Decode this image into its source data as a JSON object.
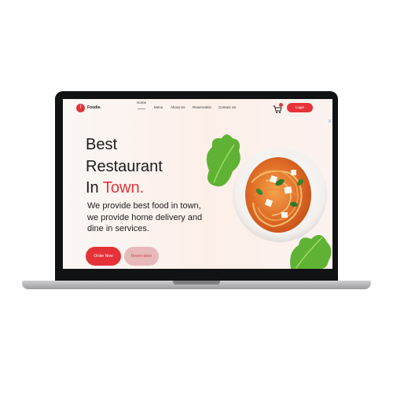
{
  "brand": {
    "name": "Foodie.",
    "logo_glyph": "f"
  },
  "nav": {
    "items": [
      {
        "label": "Home"
      },
      {
        "label": "Menu"
      },
      {
        "label": "About Us"
      },
      {
        "label": "Reservation"
      },
      {
        "label": "Contact Us"
      }
    ],
    "login_label": "Login",
    "cart_icon": "cart-icon"
  },
  "hero": {
    "title_line1": "Best",
    "title_line2": "Restaurant",
    "title_line3_prefix": "In ",
    "title_line3_accent": "Town.",
    "description": "We provide best food in town, we provide home delivery and dine in services.",
    "order_label": "Order Now",
    "reservation_label": "Reservation"
  },
  "colors": {
    "accent": "#e53238",
    "reservation_bg": "#e8b9ba",
    "bezel": "#111214"
  }
}
